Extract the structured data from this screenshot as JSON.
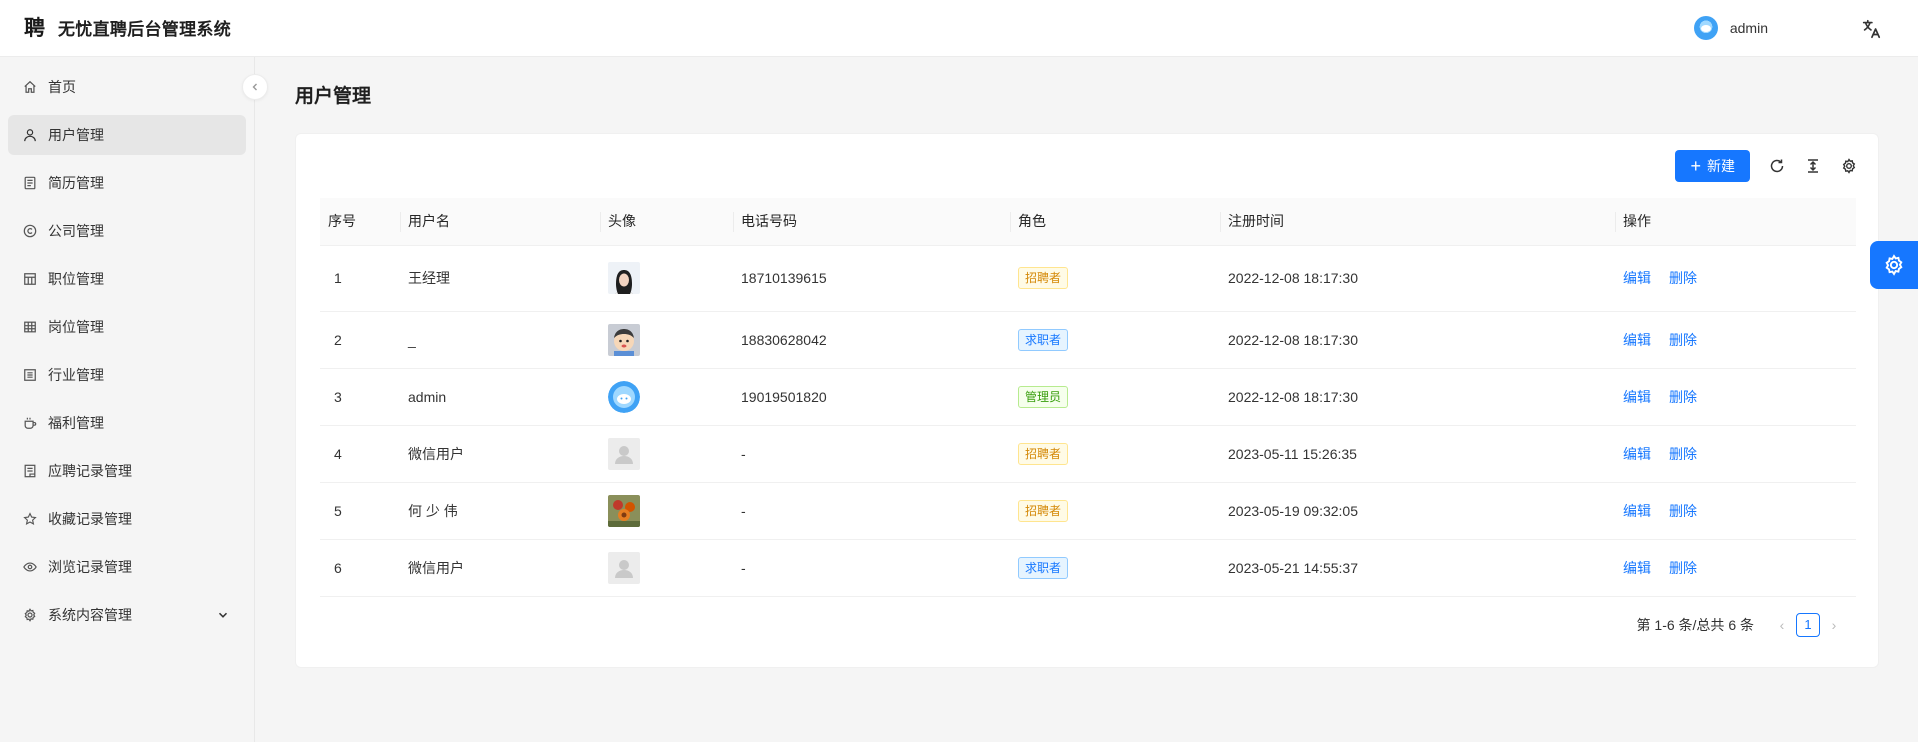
{
  "header": {
    "logo_glyph": "聘",
    "title": "无忧直聘后台管理系统",
    "username": "admin",
    "lang_icon": "translate-icon",
    "avatar_icon": "user-avatar"
  },
  "sidebar": {
    "items": [
      {
        "label": "首页",
        "icon": "home-icon"
      },
      {
        "label": "用户管理",
        "icon": "user-icon"
      },
      {
        "label": "简历管理",
        "icon": "resume-icon"
      },
      {
        "label": "公司管理",
        "icon": "copyright-icon"
      },
      {
        "label": "职位管理",
        "icon": "position-icon"
      },
      {
        "label": "岗位管理",
        "icon": "table-icon"
      },
      {
        "label": "行业管理",
        "icon": "list-icon"
      },
      {
        "label": "福利管理",
        "icon": "coffee-icon"
      },
      {
        "label": "应聘记录管理",
        "icon": "record-icon"
      },
      {
        "label": "收藏记录管理",
        "icon": "star-icon"
      },
      {
        "label": "浏览记录管理",
        "icon": "eye-icon"
      },
      {
        "label": "系统内容管理",
        "icon": "settings-icon"
      }
    ],
    "active_index": 1
  },
  "main": {
    "page_title": "用户管理",
    "toolbar": {
      "new_label": "新建"
    },
    "table": {
      "columns": [
        "序号",
        "用户名",
        "头像",
        "电话号码",
        "角色",
        "注册时间",
        "操作"
      ],
      "rows": [
        {
          "idx": "1",
          "name": "王经理",
          "avatar": "photo-woman",
          "phone": "18710139615",
          "role": "招聘者",
          "role_color": "orange",
          "time": "2022-12-08 18:17:30"
        },
        {
          "idx": "2",
          "name": "_",
          "avatar": "cartoon-boy",
          "phone": "18830628042",
          "role": "求职者",
          "role_color": "blue",
          "time": "2022-12-08 18:17:30"
        },
        {
          "idx": "3",
          "name": "admin",
          "avatar": "blue-circle",
          "phone": "19019501820",
          "role": "管理员",
          "role_color": "green",
          "time": "2022-12-08 18:17:30"
        },
        {
          "idx": "4",
          "name": "微信用户",
          "avatar": "default-placeholder",
          "phone": "-",
          "role": "招聘者",
          "role_color": "orange",
          "time": "2023-05-11 15:26:35"
        },
        {
          "idx": "5",
          "name": "何 少 伟",
          "avatar": "photo-flower",
          "phone": "-",
          "role": "招聘者",
          "role_color": "orange",
          "time": "2023-05-19 09:32:05"
        },
        {
          "idx": "6",
          "name": "微信用户",
          "avatar": "default-placeholder",
          "phone": "-",
          "role": "求职者",
          "role_color": "blue",
          "time": "2023-05-21 14:55:37"
        }
      ],
      "edit_label": "编辑",
      "delete_label": "删除"
    },
    "pagination": {
      "summary": "第 1-6 条/总共 6 条",
      "current": "1"
    }
  },
  "colors": {
    "primary": "#1677ff",
    "orange_tag": "#d48806",
    "blue_tag": "#1677ff",
    "green_tag": "#389e0d"
  }
}
